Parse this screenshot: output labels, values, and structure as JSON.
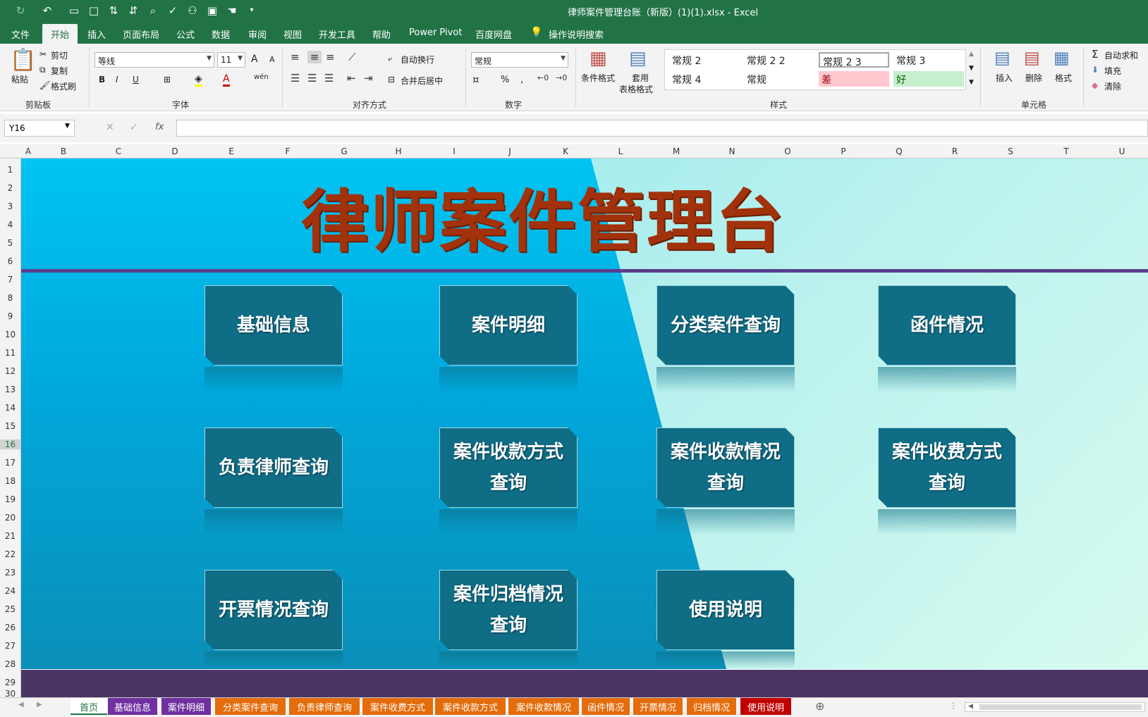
{
  "window": {
    "title": "律师案件管理台账（新版）(1)(1).xlsx  -  Excel"
  },
  "menu": {
    "tabs": [
      "文件",
      "开始",
      "插入",
      "页面布局",
      "公式",
      "数据",
      "审阅",
      "视图",
      "开发工具",
      "帮助",
      "Power Pivot",
      "百度网盘",
      "操作说明搜索"
    ],
    "active": "开始"
  },
  "ribbon": {
    "clipboard": {
      "paste": "粘贴",
      "cut": "剪切",
      "copy": "复制",
      "format_painter": "格式刷",
      "label": "剪贴板"
    },
    "font": {
      "name": "等线",
      "size": "11",
      "label": "字体",
      "bold": "B",
      "italic": "I",
      "underline": "U",
      "grow": "A",
      "shrink": "A",
      "color_letter": "A",
      "phonetic": "wén"
    },
    "alignment": {
      "wrap": "自动换行",
      "merge": "合并后居中",
      "label": "对齐方式"
    },
    "number": {
      "format": "常规",
      "label": "数字",
      "percent": "%",
      "comma": ","
    },
    "styles": {
      "conditional": "条件格式",
      "table_format_1": "套用",
      "table_format_2": "表格格式",
      "items": [
        "常规 2",
        "常规 2 2",
        "常规 2 3",
        "常规 3",
        "常规 4",
        "常规",
        "差",
        "好"
      ],
      "label": "样式"
    },
    "cells": {
      "insert": "插入",
      "delete": "删除",
      "format": "格式",
      "label": "单元格"
    },
    "editing": {
      "autosum": "自动求和",
      "fill": "填充",
      "clear": "清除"
    }
  },
  "formula_bar": {
    "name_box": "Y16",
    "formula": "",
    "fx": "fx"
  },
  "columns": [
    "A",
    "B",
    "C",
    "D",
    "E",
    "F",
    "G",
    "H",
    "I",
    "J",
    "K",
    "L",
    "M",
    "N",
    "O",
    "P",
    "Q",
    "R",
    "S",
    "T",
    "U"
  ],
  "rows": [
    "1",
    "2",
    "3",
    "4",
    "5",
    "6",
    "7",
    "8",
    "9",
    "10",
    "11",
    "12",
    "13",
    "14",
    "15",
    "16",
    "17",
    "18",
    "19",
    "20",
    "21",
    "22",
    "23",
    "24",
    "25",
    "26",
    "27",
    "28",
    "29",
    "30"
  ],
  "sheet": {
    "title": "律师案件管理台账",
    "buttons": [
      {
        "label": "基础信息"
      },
      {
        "label": "案件明细"
      },
      {
        "label": "分类案件查询"
      },
      {
        "label": "函件情况"
      },
      {
        "label": "负责律师查询"
      },
      {
        "label": "案件收款方式查询"
      },
      {
        "label": "案件收款情况查询"
      },
      {
        "label": "案件收费方式查询"
      },
      {
        "label": "开票情况查询"
      },
      {
        "label": "案件归档情况查询"
      },
      {
        "label": "使用说明"
      }
    ]
  },
  "sheet_tabs": [
    {
      "label": "首页",
      "color": "#ffffff"
    },
    {
      "label": "基础信息",
      "color": "#7030a0"
    },
    {
      "label": "案件明细",
      "color": "#7030a0"
    },
    {
      "label": "分类案件查询",
      "color": "#e46c0a"
    },
    {
      "label": "负责律师查询",
      "color": "#e46c0a"
    },
    {
      "label": "案件收费方式",
      "color": "#e46c0a"
    },
    {
      "label": "案件收款方式",
      "color": "#e46c0a"
    },
    {
      "label": "案件收款情况",
      "color": "#e46c0a"
    },
    {
      "label": "函件情况",
      "color": "#e46c0a"
    },
    {
      "label": "开票情况",
      "color": "#e46c0a"
    },
    {
      "label": "归档情况",
      "color": "#e46c0a"
    },
    {
      "label": "使用说明",
      "color": "#c00000"
    }
  ],
  "colors": {
    "excel_green": "#217346",
    "title_red": "#a2320b",
    "button_teal": "#0f6d86",
    "band_purple": "#4b3466"
  }
}
